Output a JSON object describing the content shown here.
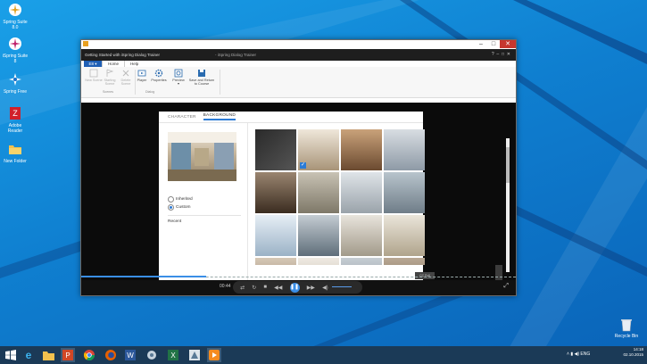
{
  "desktop": {
    "icons": [
      {
        "label": "Spring Suite 8.0"
      },
      {
        "label": "iSpring Suite 8"
      },
      {
        "label": "Spring Free"
      },
      {
        "label": "Adobe Reader"
      },
      {
        "label": "New Folder"
      }
    ],
    "recycle_bin": "Recycle Bin"
  },
  "window": {
    "app_title": "Getting Started with iSpring Dialog Trainer",
    "app_title_sub": "- iSpring Dialog Trainer",
    "file_tab": "E8 ▾",
    "tabs": [
      "Home",
      "Help"
    ],
    "ribbon": {
      "buttons": [
        {
          "label": "New Scene",
          "disabled": true
        },
        {
          "label": "Starting Scene",
          "disabled": true
        },
        {
          "label": "Delete Scene",
          "disabled": true
        },
        {
          "label": "Player",
          "disabled": false
        },
        {
          "label": "Properties",
          "disabled": false
        },
        {
          "label": "Preview",
          "disabled": false
        },
        {
          "label": "Save and Return to Course",
          "disabled": false
        }
      ],
      "groups": [
        "Scenes",
        "Dialog"
      ]
    }
  },
  "dialog": {
    "tabs": [
      "CHARACTER",
      "BACKGROUND"
    ],
    "active_tab": "BACKGROUND",
    "options": [
      "Inherited",
      "Custom"
    ],
    "selected_option": "Custom",
    "recent_label": "Recent"
  },
  "player": {
    "time": "00:44",
    "caption": "CC Full"
  },
  "taskbar": {
    "time": "14:18",
    "date": "02.10.2015",
    "lang": "ENG"
  },
  "colors": {
    "accent": "#2b7bd6",
    "desktop": "#1590dd",
    "taskbar": "#1b3a57",
    "close": "#c7372f"
  }
}
